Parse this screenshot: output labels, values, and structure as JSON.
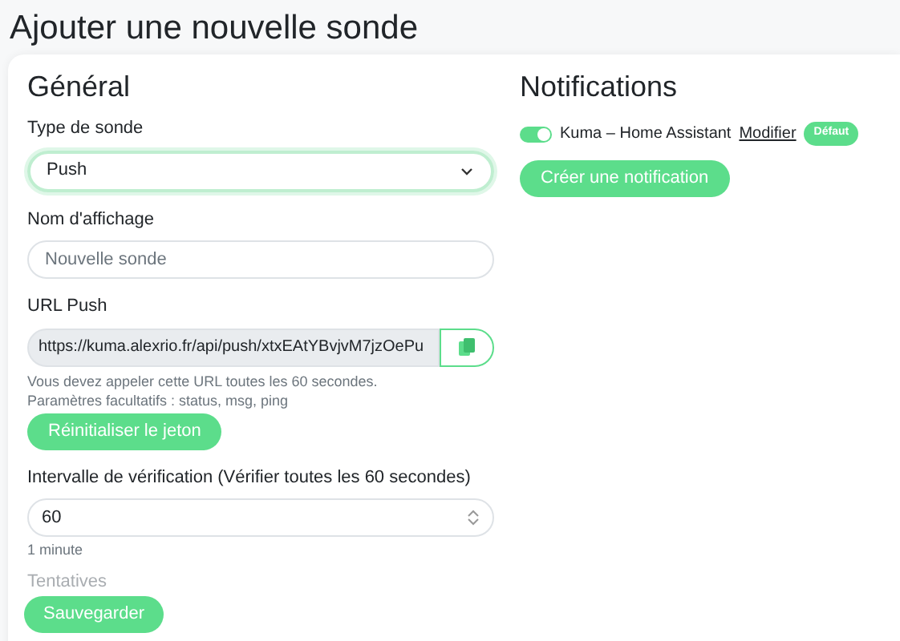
{
  "page_title": "Ajouter une nouvelle sonde",
  "general": {
    "heading": "Général",
    "monitor_type": {
      "label": "Type de sonde",
      "value": "Push"
    },
    "display_name": {
      "label": "Nom d'affichage",
      "placeholder": "Nouvelle sonde"
    },
    "push_url": {
      "label": "URL Push",
      "value": "https://kuma.alexrio.fr/api/push/xtxEAtYBvjvM7jzOePu",
      "help": [
        "Vous devez appeler cette URL toutes les 60 secondes.",
        "Paramètres facultatifs : status, msg, ping"
      ],
      "reset_button": "Réinitialiser le jeton"
    },
    "interval": {
      "label": "Intervalle de vérification (Vérifier toutes les 60 secondes)",
      "value": "60",
      "help": "1 minute"
    },
    "retries": {
      "label": "Tentatives"
    }
  },
  "notifications": {
    "heading": "Notifications",
    "items": [
      {
        "name": "Kuma – Home Assistant",
        "on": true,
        "edit_link": "Modifier",
        "badge": "Défaut"
      }
    ],
    "create_button": "Créer une notification"
  },
  "save_button": "Sauvegarder"
}
